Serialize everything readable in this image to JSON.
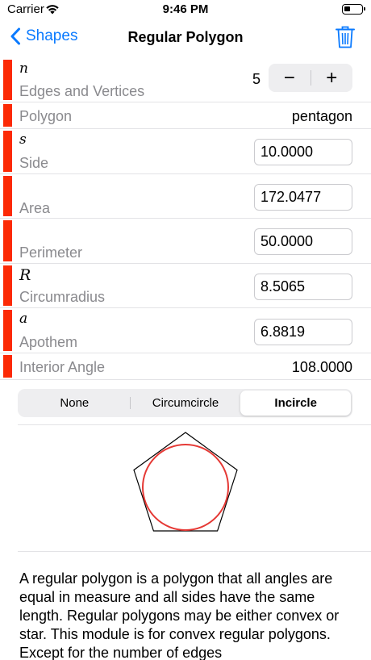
{
  "status_bar": {
    "carrier": "Carrier",
    "time": "9:46 PM"
  },
  "nav": {
    "back_label": "Shapes",
    "title": "Regular Polygon"
  },
  "rows": {
    "edges": {
      "symbol": "n",
      "label": "Edges and Vertices",
      "value": "5"
    },
    "polygon": {
      "label": "Polygon",
      "value": "pentagon"
    },
    "side": {
      "symbol": "s",
      "label": "Side",
      "value": "10.0000"
    },
    "area": {
      "label": "Area",
      "value": "172.0477"
    },
    "perimeter": {
      "label": "Perimeter",
      "value": "50.0000"
    },
    "circumradius": {
      "symbol": "R",
      "label": "Circumradius",
      "value": "8.5065"
    },
    "apothem": {
      "symbol": "a",
      "label": "Apothem",
      "value": "6.8819"
    },
    "interior_angle": {
      "label": "Interior Angle",
      "value": "108.0000"
    }
  },
  "stepper": {
    "minus": "−",
    "plus": "+"
  },
  "segments": {
    "options": [
      "None",
      "Circumcircle",
      "Incircle"
    ],
    "selected": "Incircle"
  },
  "description": "A regular polygon is a polygon that all angles are equal in measure and all sides have the same length. Regular polygons may be either convex or star. This module is for convex regular polygons. Except for the number of edges",
  "colors": {
    "accent": "#0a7aff",
    "marker": "#fc2a05",
    "incircle": "#e53935"
  },
  "icons": {
    "back": "chevron-left-icon",
    "trash": "trash-icon",
    "wifi": "wifi-icon",
    "battery": "battery-icon"
  }
}
